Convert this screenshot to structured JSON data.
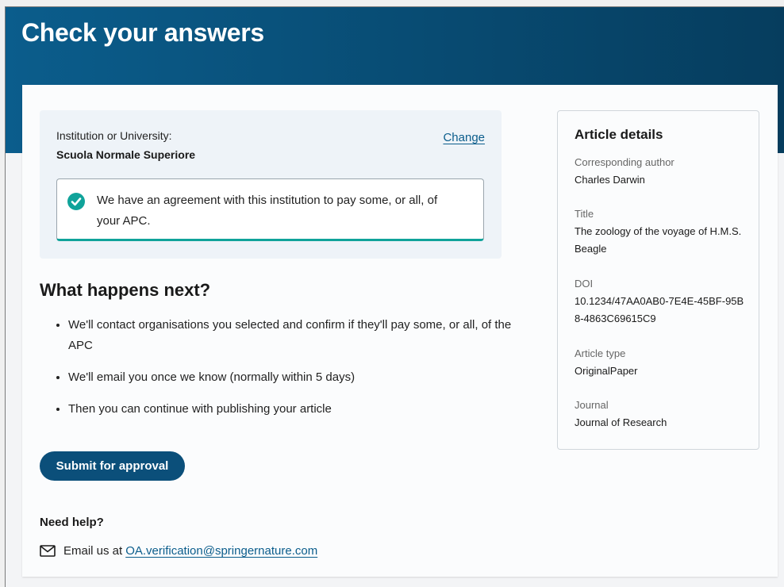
{
  "page": {
    "title": "Check your answers"
  },
  "institution": {
    "label": "Institution or University:",
    "name": "Scuola Normale Superiore",
    "change_label": "Change",
    "agreement_text": "We have an agreement with this institution to pay some, or all, of your APC."
  },
  "next_steps": {
    "heading": "What happens next?",
    "items": [
      "We'll contact organisations you selected and confirm if they'll pay some, or all, of the APC",
      "We'll email you once we know (normally within 5 days)",
      "Then you can continue with publishing your article"
    ]
  },
  "actions": {
    "submit_label": "Submit for approval"
  },
  "help": {
    "heading": "Need help?",
    "email_prefix": "Email us at",
    "email_address": "OA.verification@springernature.com"
  },
  "article_details": {
    "title": "Article details",
    "fields": [
      {
        "label": "Corresponding author",
        "value": "Charles Darwin"
      },
      {
        "label": "Title",
        "value": "The zoology of the voyage of H.M.S. Beagle"
      },
      {
        "label": "DOI",
        "value": "10.1234/47AA0AB0-7E4E-45BF-95B8-4863C69615C9"
      },
      {
        "label": "Article type",
        "value": "OriginalPaper"
      },
      {
        "label": "Journal",
        "value": "Journal of Research"
      }
    ]
  },
  "colors": {
    "banner": "#0b5d8c",
    "accent": "#0b4f7a",
    "success": "#10a39a",
    "link": "#0b5d8c"
  },
  "icons": {
    "success": "check-circle-icon",
    "email": "mail-icon"
  }
}
